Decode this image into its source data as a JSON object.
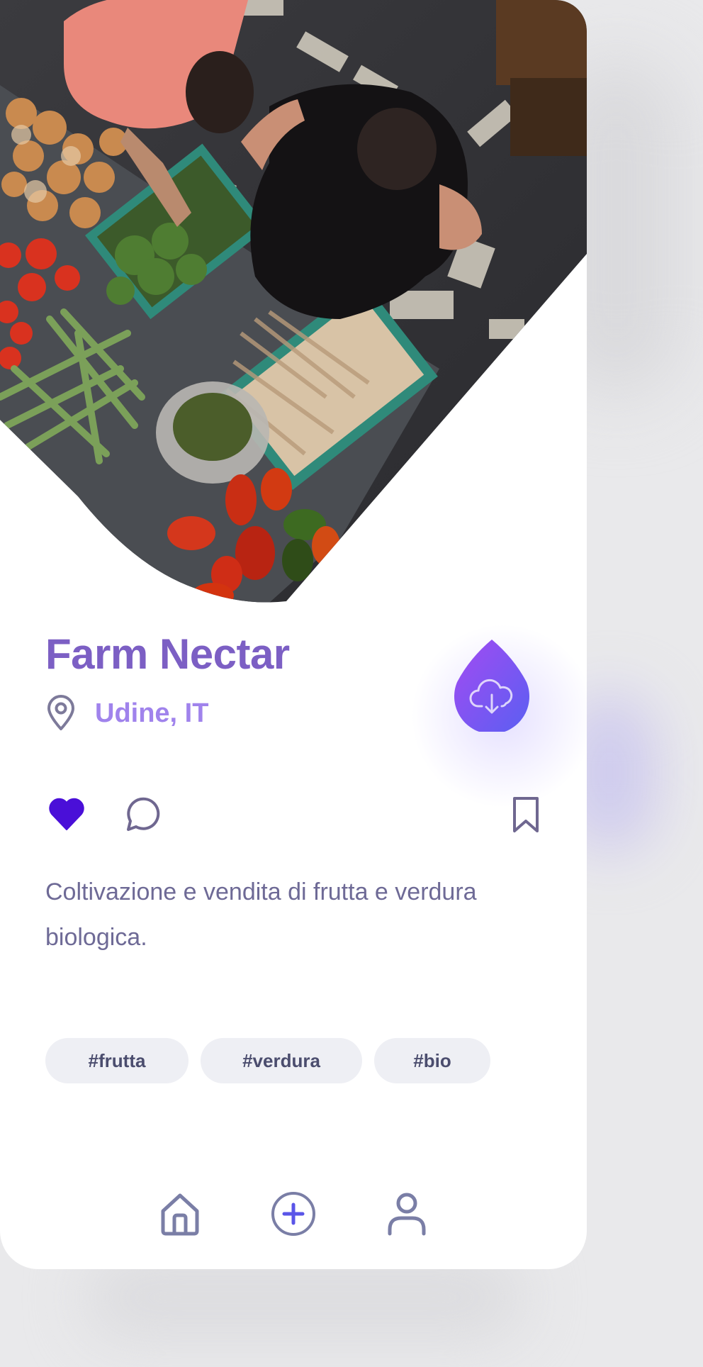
{
  "place": {
    "name": "Farm Nectar",
    "location": "Udine, IT",
    "description": "Coltivazione e vendita di frutta e verdura biologica."
  },
  "tags": [
    "#frutta",
    "#verdura",
    "#bio"
  ],
  "actions": {
    "like_icon": "heart-filled-icon",
    "comment_icon": "comment-icon",
    "bookmark_icon": "bookmark-icon",
    "download_icon": "cloud-download-icon"
  },
  "tabbar": {
    "home_icon": "home-icon",
    "add_icon": "plus-circle-icon",
    "profile_icon": "user-icon"
  },
  "colors": {
    "title": "#7c5fc4",
    "location": "#a083ec",
    "like": "#4a0fd8",
    "accent_start": "#a34bf2",
    "accent_end": "#5a5ff2",
    "tag_bg": "#eeeff4",
    "tag_text": "#4b4d6e"
  }
}
